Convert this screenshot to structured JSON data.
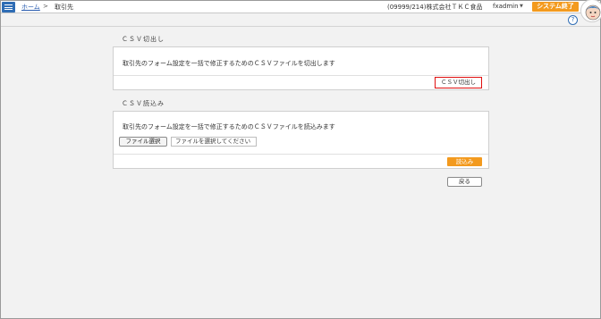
{
  "header": {
    "breadcrumb_home": "ホーム",
    "breadcrumb_sep": ">",
    "breadcrumb_current": "取引先",
    "company": "(09999/214)株式会社ＴＫＣ食品",
    "user": "fxadmin",
    "exit_label": "システム終了",
    "help_symbol": "?"
  },
  "export_section": {
    "title": "ＣＳＶ切出し",
    "description": "取引先のフォーム設定を一括で修正するためのＣＳＶファイルを切出します",
    "button_label": "ＣＳＶ切出し"
  },
  "import_section": {
    "title": "ＣＳＶ読込み",
    "description": "取引先のフォーム設定を一括で修正するためのＣＳＶファイルを読込みます",
    "file_button_label": "ファイル選択",
    "file_placeholder": "ファイルを選択してください",
    "import_button_label": "読込み"
  },
  "footer": {
    "back_label": "戻る"
  },
  "colors": {
    "accent_blue": "#2f6db5",
    "accent_orange": "#f39a1e",
    "highlight_red": "#e01010"
  }
}
